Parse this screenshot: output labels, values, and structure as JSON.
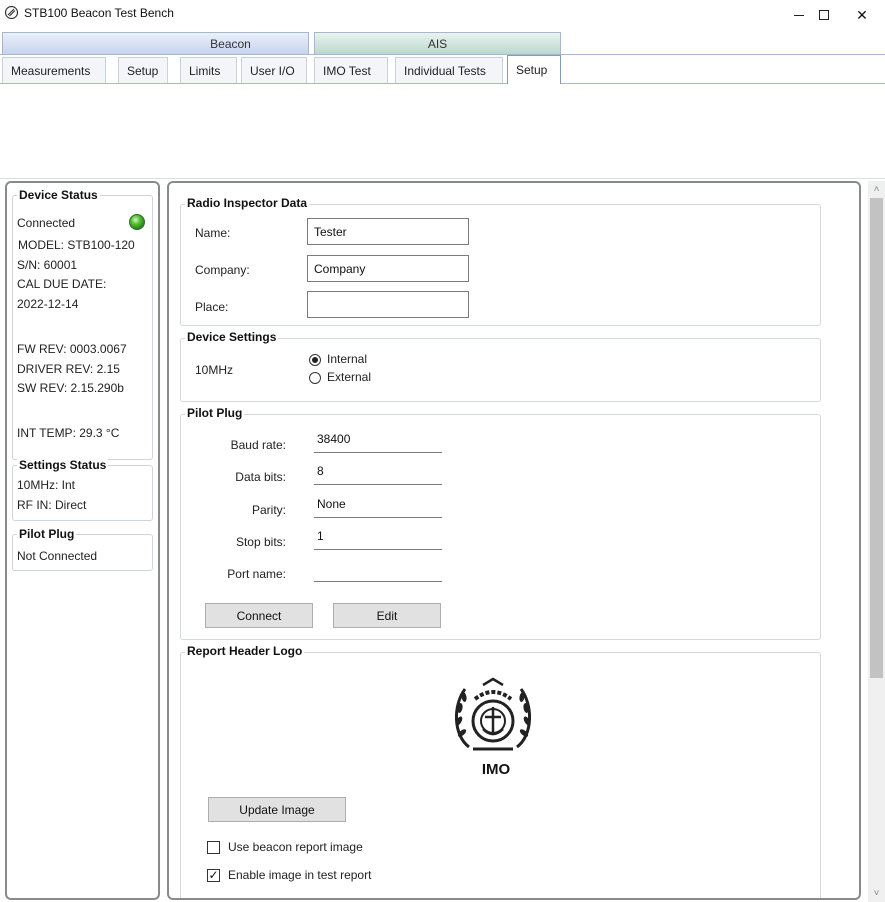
{
  "window": {
    "title": "STB100 Beacon Test Bench",
    "min": "–",
    "max": "□",
    "close": "✕"
  },
  "tab_groups": [
    {
      "label": "Beacon",
      "color": "#c6d4ee"
    },
    {
      "label": "AIS",
      "color": "#bcd7cf"
    }
  ],
  "tabs": [
    {
      "label": "Measurements"
    },
    {
      "label": "Setup"
    },
    {
      "label": "Limits"
    },
    {
      "label": "User I/O"
    },
    {
      "label": "IMO Test"
    },
    {
      "label": "Individual Tests"
    },
    {
      "label": "Setup",
      "selected": true
    }
  ],
  "device_status": {
    "title": "Device Status",
    "state": "Connected",
    "led_color": "#3fb52a",
    "model": "MODEL: STB100-120",
    "sn": "S/N: 60001",
    "cal_due_label": "CAL DUE DATE:",
    "cal_due_value": "2022-12-14",
    "fw_rev": "FW REV: 0003.0067",
    "driver_rev": "DRIVER REV: 2.15",
    "sw_rev": "SW REV: 2.15.290b",
    "int_temp": "INT TEMP: 29.3 °C"
  },
  "settings_status": {
    "title": "Settings Status",
    "clock": "10MHz: Int",
    "rf_in": "RF IN: Direct"
  },
  "pilot_plug_status": {
    "title": "Pilot Plug",
    "state": "Not Connected"
  },
  "radio_inspector": {
    "title": "Radio Inspector Data",
    "name_label": "Name:",
    "name_value": "Tester",
    "company_label": "Company:",
    "company_value": "Company",
    "place_label": "Place:",
    "place_value": ""
  },
  "device_settings": {
    "title": "Device Settings",
    "clock_label": "10MHz",
    "options": [
      "Internal",
      "External"
    ],
    "selected": "Internal"
  },
  "pilot_plug": {
    "title": "Pilot Plug",
    "baud_label": "Baud rate:",
    "baud_value": "38400",
    "data_bits_label": "Data bits:",
    "data_bits_value": "8",
    "parity_label": "Parity:",
    "parity_value": "None",
    "stop_bits_label": "Stop bits:",
    "stop_bits_value": "1",
    "port_label": "Port name:",
    "port_value": "",
    "connect_button": "Connect",
    "edit_button": "Edit"
  },
  "report_logo": {
    "title": "Report Header Logo",
    "logo_text": "IMO",
    "update_button": "Update Image",
    "use_beacon_label": "Use beacon report image",
    "use_beacon_checked": false,
    "enable_image_label": "Enable image in test report",
    "enable_image_checked": true
  },
  "scrollbar": {
    "up": "˄",
    "down": "˅"
  }
}
